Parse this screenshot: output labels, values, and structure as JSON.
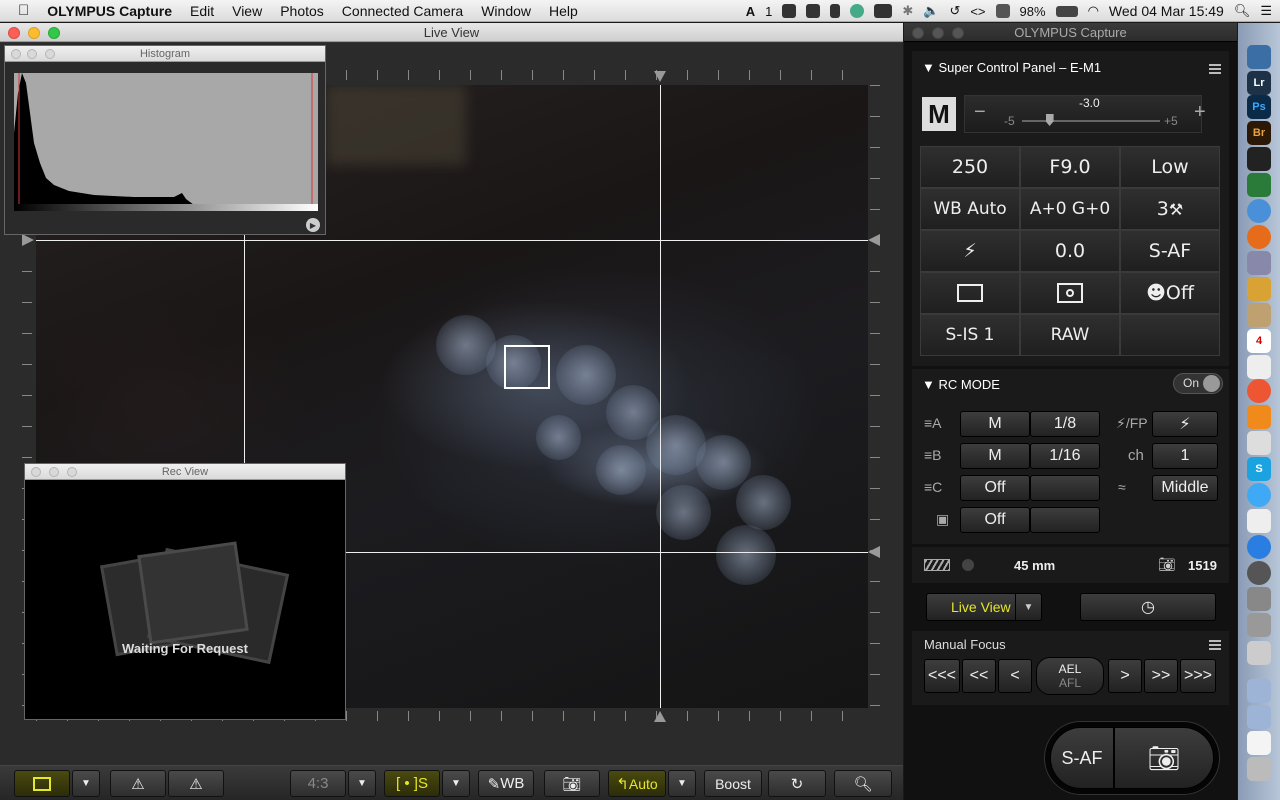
{
  "menubar": {
    "app": "OLYMPUS Capture",
    "items": [
      "Edit",
      "View",
      "Photos",
      "Connected Camera",
      "Window",
      "Help"
    ],
    "tray_one": "1",
    "battery": "98%",
    "datetime": "Wed 04 Mar  15:49"
  },
  "liveview": {
    "title": "Live View"
  },
  "histogram": {
    "title": "Histogram"
  },
  "recview": {
    "title": "Rec View",
    "status": "Waiting For Request"
  },
  "toolbar": {
    "aspect": "4:3",
    "af_target": "[ • ]S",
    "wb": "WB",
    "auto": "Auto",
    "boost": "Boost"
  },
  "panel": {
    "title": "OLYMPUS Capture",
    "scp_title": "Super Control Panel – E-M1",
    "mode": "M",
    "exposure": "-3.0",
    "exp_min": "-5",
    "exp_max": "+5",
    "exposure_fraction": 0.2,
    "grid": [
      "250",
      "F9.0",
      "Low",
      "WB Auto",
      "A+0 G+0",
      "3",
      "",
      "0.0",
      "S-AF",
      "",
      "",
      "Off",
      "S-IS 1",
      "RAW",
      ""
    ],
    "rc_title": "RC MODE",
    "rc_toggle": "On",
    "rc": {
      "a_mode": "M",
      "a_val": "1/8",
      "b_mode": "M",
      "b_val": "1/16",
      "c_mode": "Off",
      "d_mode": "Off",
      "fp_label": "/FP",
      "ch_label": "ch",
      "ch_val": "1",
      "level": "Middle",
      "a": "A",
      "b": "B",
      "c": "C"
    },
    "focal": "45 mm",
    "shots": "1519",
    "liveview_select": "Live View",
    "mf_title": "Manual Focus",
    "mf_buttons": [
      "<<<",
      "<<",
      "<",
      "AEL",
      "AFL",
      ">",
      ">>",
      ">>>"
    ],
    "shutter_af": "S-AF"
  },
  "colors": {
    "accent_yellow": "#e6e62a",
    "panel_bg": "#111111"
  }
}
